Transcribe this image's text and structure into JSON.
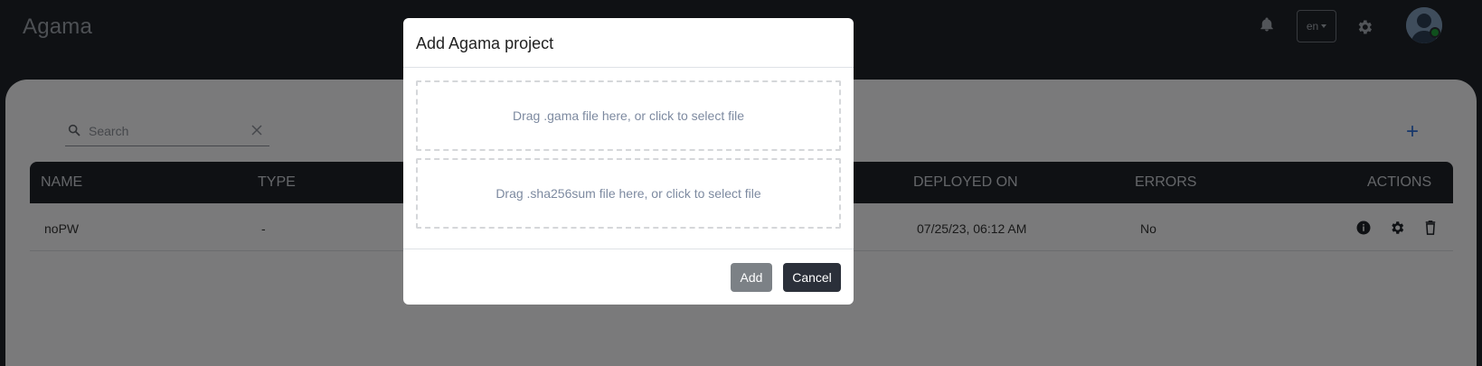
{
  "header": {
    "app_title": "Agama",
    "language": "en"
  },
  "search": {
    "placeholder": "Search"
  },
  "table": {
    "columns": [
      "NAME",
      "TYPE",
      "DEPLOYED ON",
      "ERRORS",
      "ACTIONS"
    ],
    "rows": [
      {
        "name": "noPW",
        "type": "-",
        "deployed_on": "07/25/23, 06:12 AM",
        "errors": "No"
      }
    ]
  },
  "modal": {
    "title": "Add Agama project",
    "dropzone_gama": "Drag .gama file here, or click to select file",
    "dropzone_sha": "Drag .sha256sum file here, or click to select file",
    "add_label": "Add",
    "cancel_label": "Cancel"
  },
  "icons": {
    "bell": "bell-icon",
    "settings": "gear-icon",
    "search": "search-icon",
    "clear": "close-icon",
    "add": "plus-icon",
    "info": "info-icon",
    "delete": "trash-icon"
  },
  "colors": {
    "header_bg": "#1f2228",
    "card_bg": "#f4f5f7",
    "accent": "#2f6fd6",
    "status_online": "#1f9e3a",
    "cancel_button": "#2b303a",
    "add_button": "#7c8186"
  }
}
